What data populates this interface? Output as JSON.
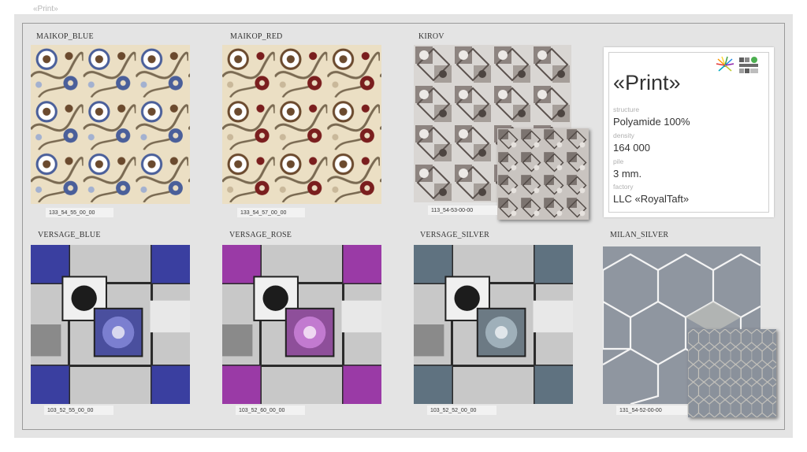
{
  "header": {
    "title": "«Print»"
  },
  "products": [
    {
      "name": "MAIKOP_BLUE",
      "code": "133_54_55_00_00"
    },
    {
      "name": "MAIKOP_RED",
      "code": "133_54_57_00_00"
    },
    {
      "name": "KIROV",
      "code": "113_54-53-00-00"
    },
    {
      "name": "VERSAGE_BLUE",
      "code": "103_52_55_00_00"
    },
    {
      "name": "VERSAGE_ROSE",
      "code": "103_52_60_00_00"
    },
    {
      "name": "VERSAGE_SILVER",
      "code": "103_52_52_00_00"
    },
    {
      "name": "MILAN_SILVER",
      "code": "131_54-52-00-00"
    }
  ],
  "info": {
    "title": "«Print»",
    "structure_label": "structure",
    "structure_value": "Polyamide 100%",
    "density_label": "density",
    "density_value": "164 000",
    "pile_label": "pile",
    "pile_value": "3 mm.",
    "factory_label": "factory",
    "factory_value": "LLC «RoyalTaft»"
  },
  "colors": {
    "maikop_bg": "#e9dcc1",
    "maikop_blue_accent": "#4a5f9a",
    "maikop_red_accent": "#7a1e1e",
    "versage_blue_accent": "#3a3fa0",
    "versage_rose_accent": "#9a3aa6",
    "versage_silver_accent": "#5f7280",
    "milan_bg": "#8f96a0"
  }
}
